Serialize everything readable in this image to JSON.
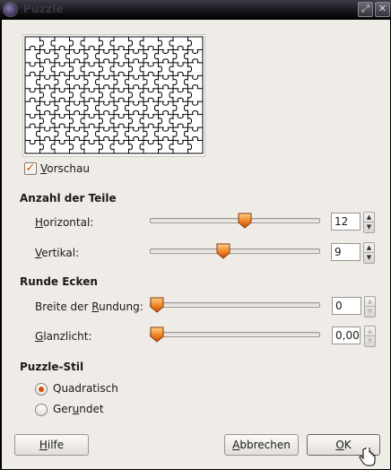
{
  "window": {
    "title": "Puzzle"
  },
  "preview": {
    "columns": 12,
    "rows": 9
  },
  "vorschau": {
    "label": "Vorschau",
    "checked": true
  },
  "anzahl": {
    "header": "Anzahl der Teile",
    "horizontal": {
      "label": "Horizontal:",
      "value": "12",
      "level": 0.57
    },
    "vertikal": {
      "label": "Vertikal:",
      "value": "9",
      "level": 0.43
    }
  },
  "ecken": {
    "header": "Runde Ecken",
    "breite": {
      "label": "Breite der Rundung:",
      "value": "0",
      "level": 0.0
    },
    "glanz": {
      "label": "Glanzlicht:",
      "value": "0,00",
      "level": 0.0
    }
  },
  "stil": {
    "header": "Puzzle-Stil",
    "options": [
      {
        "label": "Quadratisch",
        "selected": true
      },
      {
        "label": "Gerundet",
        "selected": false
      }
    ]
  },
  "buttons": {
    "help": "Hilfe",
    "cancel": "Abbrechen",
    "ok": "OK"
  },
  "colors": {
    "accent": "#d2520b",
    "dialog_bg": "#efebe7"
  }
}
